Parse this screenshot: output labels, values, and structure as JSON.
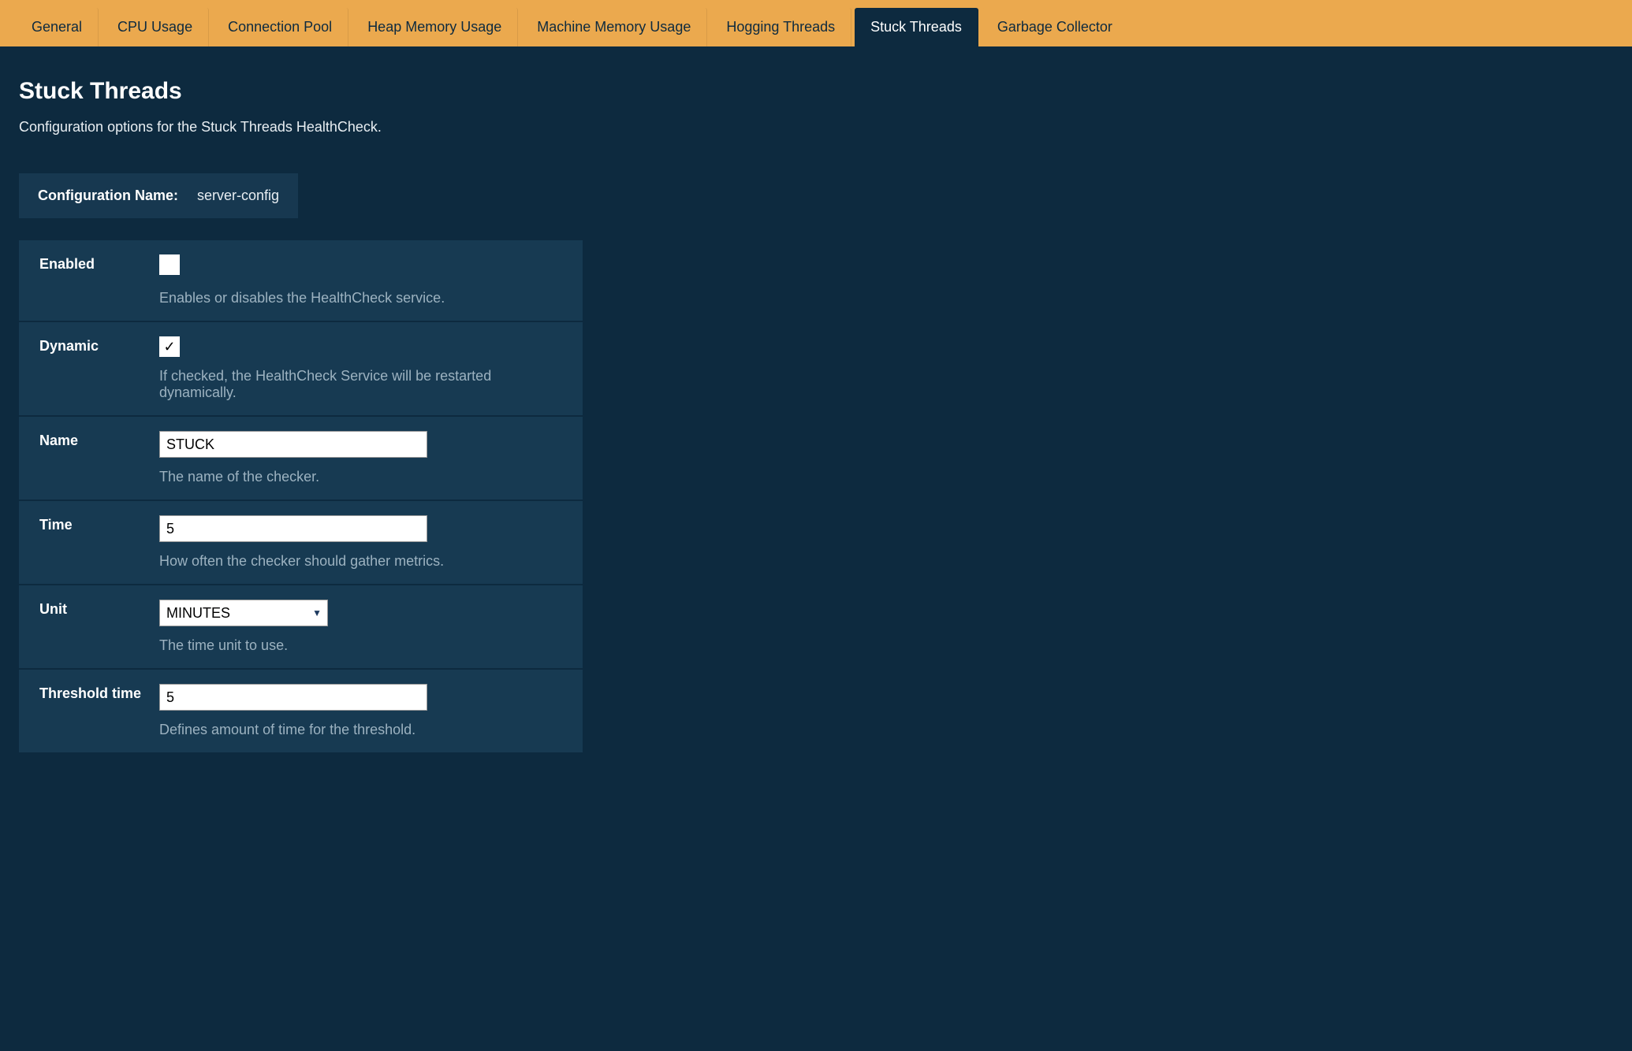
{
  "tabs": [
    {
      "label": "General",
      "active": false
    },
    {
      "label": "CPU Usage",
      "active": false
    },
    {
      "label": "Connection Pool",
      "active": false
    },
    {
      "label": "Heap Memory Usage",
      "active": false
    },
    {
      "label": "Machine Memory Usage",
      "active": false
    },
    {
      "label": "Hogging Threads",
      "active": false
    },
    {
      "label": "Stuck Threads",
      "active": true
    },
    {
      "label": "Garbage Collector",
      "active": false
    }
  ],
  "page": {
    "title": "Stuck Threads",
    "subtitle": "Configuration options for the Stuck Threads HealthCheck."
  },
  "config_name": {
    "label": "Configuration Name:",
    "value": "server-config"
  },
  "fields": {
    "enabled": {
      "label": "Enabled",
      "checked": false,
      "help": "Enables or disables the HealthCheck service."
    },
    "dynamic": {
      "label": "Dynamic",
      "checked": true,
      "help": "If checked, the HealthCheck Service will be restarted dynamically."
    },
    "name": {
      "label": "Name",
      "value": "STUCK",
      "help": "The name of the checker."
    },
    "time": {
      "label": "Time",
      "value": "5",
      "help": "How often the checker should gather metrics."
    },
    "unit": {
      "label": "Unit",
      "value": "MINUTES",
      "help": "The time unit to use."
    },
    "threshold_time": {
      "label": "Threshold time",
      "value": "5",
      "help": "Defines amount of time for the threshold."
    }
  }
}
